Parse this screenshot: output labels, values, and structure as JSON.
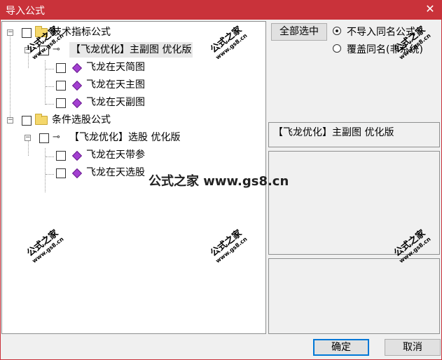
{
  "window": {
    "title": "导入公式",
    "close_icon": "close-icon"
  },
  "tree": {
    "nodes": [
      {
        "label": "技术指标公式",
        "icon": "folder-icon",
        "checked": false,
        "expander": "⊟"
      },
      {
        "label": "【飞龙优化】主副图 优化版",
        "icon": "key-icon",
        "checked": false,
        "expander": "⊟",
        "selected": true
      },
      {
        "label": "飞龙在天简图",
        "icon": "diamond-icon",
        "checked": false
      },
      {
        "label": "飞龙在天主图",
        "icon": "diamond-icon",
        "checked": false
      },
      {
        "label": "飞龙在天副图",
        "icon": "diamond-icon",
        "checked": false
      },
      {
        "label": "条件选股公式",
        "icon": "folder-icon",
        "checked": false,
        "expander": "⊟"
      },
      {
        "label": "【飞龙优化】选股 优化版",
        "icon": "key-icon",
        "checked": false,
        "expander": "⊟"
      },
      {
        "label": "飞龙在天带参",
        "icon": "diamond-icon",
        "checked": false
      },
      {
        "label": "飞龙在天选股",
        "icon": "diamond-icon",
        "checked": false
      }
    ]
  },
  "right": {
    "select_all_label": "全部选中",
    "radio_options": [
      {
        "label": "不导入同名公式",
        "selected": true
      },
      {
        "label": "覆盖同名(非系统)",
        "selected": false
      }
    ],
    "selected_name": "【飞龙优化】主副图 优化版"
  },
  "buttons": {
    "ok_label": "确定",
    "cancel_label": "取消"
  },
  "watermark": {
    "big": "公式之家",
    "small": "www.gs8.cn",
    "center": "公式之家 www.gs8.cn"
  },
  "colors": {
    "titlebar": "#c9323a",
    "accent": "#0078d7"
  }
}
